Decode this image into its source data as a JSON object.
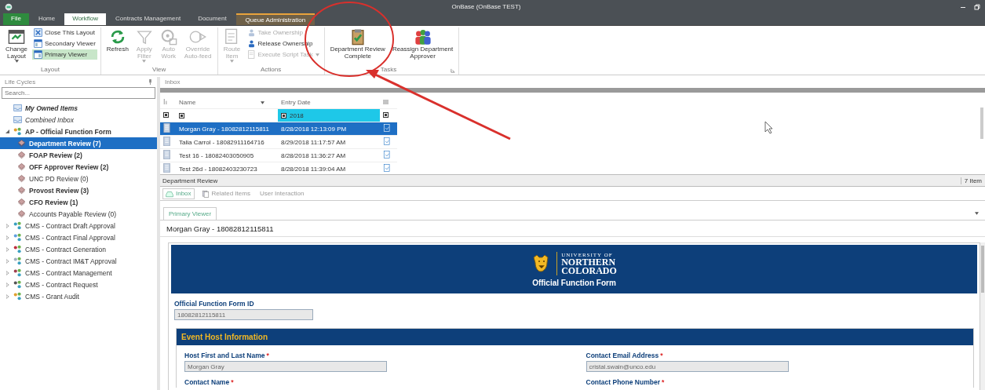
{
  "window": {
    "title": "OnBase (OnBase TEST)"
  },
  "ribbon_tabs": [
    {
      "label": "File",
      "kind": "file",
      "selected": false
    },
    {
      "label": "Home",
      "kind": "normal",
      "selected": false
    },
    {
      "label": "Workflow",
      "kind": "normal",
      "selected": true
    },
    {
      "label": "Contracts Management",
      "kind": "normal",
      "selected": false
    },
    {
      "label": "Document",
      "kind": "normal",
      "selected": false
    },
    {
      "label": "Queue Administration",
      "kind": "contextual",
      "selected": false
    }
  ],
  "ribbon_groups": [
    {
      "label": "Layout",
      "launcher": false,
      "items": [
        {
          "label": "Change\nLayout",
          "kind": "large",
          "dropdown": true,
          "disabled": false,
          "on": false
        },
        {
          "label": "Close This Layout",
          "kind": "small",
          "dropdown": false,
          "disabled": false,
          "on": false
        },
        {
          "label": "Secondary Viewer",
          "kind": "small",
          "dropdown": false,
          "disabled": false,
          "on": false
        },
        {
          "label": "Primary Viewer",
          "kind": "small",
          "dropdown": false,
          "disabled": false,
          "on": true
        }
      ]
    },
    {
      "label": "View",
      "launcher": false,
      "items": [
        {
          "label": "Refresh",
          "kind": "large",
          "dropdown": false,
          "disabled": false,
          "on": false
        },
        {
          "label": "Apply\nFilter",
          "kind": "large",
          "dropdown": true,
          "disabled": true,
          "on": false
        },
        {
          "label": "Auto\nWork",
          "kind": "large",
          "dropdown": false,
          "disabled": true,
          "on": false
        },
        {
          "label": "Override\nAuto-feed",
          "kind": "large",
          "dropdown": false,
          "disabled": true,
          "on": false
        }
      ]
    },
    {
      "label": "Actions",
      "launcher": false,
      "items": [
        {
          "label": "Route\nItem",
          "kind": "large",
          "dropdown": true,
          "disabled": true,
          "on": false
        },
        {
          "label": "Take Ownership",
          "kind": "small",
          "dropdown": false,
          "disabled": true,
          "on": false
        },
        {
          "label": "Release Ownership",
          "kind": "small",
          "dropdown": false,
          "disabled": false,
          "on": false
        },
        {
          "label": "Execute Script Task",
          "kind": "small",
          "dropdown": true,
          "disabled": true,
          "on": false
        }
      ]
    },
    {
      "label": "Tasks",
      "launcher": true,
      "items": [
        {
          "label": "Department Review\nComplete",
          "kind": "large",
          "dropdown": false,
          "disabled": false,
          "on": false
        },
        {
          "label": "Reassign Department\nApprover",
          "kind": "large",
          "dropdown": false,
          "disabled": false,
          "on": false
        }
      ]
    }
  ],
  "sidebar": {
    "title": "Life Cycles",
    "search": {
      "placeholder": "Search..."
    },
    "tree": [
      {
        "label": "My Owned Items",
        "kind": "view",
        "emphasized": true,
        "selected": false
      },
      {
        "label": "Combined Inbox",
        "kind": "view",
        "emphasized": false,
        "selected": false
      },
      {
        "label": "AP - Official Function Form",
        "kind": "lifecycle",
        "emphasized": true,
        "expanded": true,
        "selected": false,
        "children": [
          {
            "label": "Department Review (7)",
            "kind": "queue",
            "emphasized": true,
            "selected": true
          },
          {
            "label": "FOAP Review (2)",
            "kind": "queue",
            "emphasized": true,
            "selected": false
          },
          {
            "label": "OFF Approver Review (2)",
            "kind": "queue",
            "emphasized": true,
            "selected": false
          },
          {
            "label": "UNC PD Review (0)",
            "kind": "queue",
            "emphasized": false,
            "selected": false
          },
          {
            "label": "Provost Review (3)",
            "kind": "queue",
            "emphasized": true,
            "selected": false
          },
          {
            "label": "CFO Review (1)",
            "kind": "queue",
            "emphasized": true,
            "selected": false
          },
          {
            "label": "Accounts Payable Review (0)",
            "kind": "queue",
            "emphasized": false,
            "selected": false
          }
        ]
      },
      {
        "label": "CMS - Contract Draft Approval",
        "kind": "lifecycle",
        "emphasized": false,
        "expanded": false,
        "selected": false
      },
      {
        "label": "CMS - Contract Final Approval",
        "kind": "lifecycle",
        "emphasized": false,
        "expanded": false,
        "selected": false
      },
      {
        "label": "CMS - Contract Generation",
        "kind": "lifecycle",
        "emphasized": false,
        "expanded": false,
        "selected": false
      },
      {
        "label": "CMS - Contract IM&T Approval",
        "kind": "lifecycle",
        "emphasized": false,
        "expanded": false,
        "selected": false
      },
      {
        "label": "CMS - Contract Management",
        "kind": "lifecycle",
        "emphasized": false,
        "expanded": false,
        "selected": false
      },
      {
        "label": "CMS - Contract Request",
        "kind": "lifecycle",
        "emphasized": false,
        "expanded": false,
        "selected": false
      },
      {
        "label": "CMS - Grant Audit",
        "kind": "lifecycle",
        "emphasized": false,
        "expanded": false,
        "selected": false
      }
    ]
  },
  "inbox": {
    "title": "Inbox",
    "table": {
      "columns": [
        {
          "label": "Name"
        },
        {
          "label": "Entry Date"
        }
      ],
      "filters": [
        {
          "active": false
        },
        {
          "value": "2018",
          "active": true
        }
      ],
      "rows": [
        {
          "name": "Morgan Gray - 18082812115811",
          "entry_date": "8/28/2018 12:13:09 PM",
          "selected": true
        },
        {
          "name": "Talia Carrol - 18082911164716",
          "entry_date": "8/29/2018 11:17:57 AM",
          "selected": false
        },
        {
          "name": "Test 16 - 18082403050905",
          "entry_date": "8/28/2018 11:36:27 AM",
          "selected": false
        },
        {
          "name": "Test 26d - 18082403230723",
          "entry_date": "8/28/2018 11:39:04 AM",
          "selected": false
        }
      ]
    },
    "status_bar": {
      "queue": "Department Review",
      "count": "7 Item"
    }
  },
  "detail_tabs": [
    {
      "label": "Inbox",
      "selected": true
    },
    {
      "label": "Related Items",
      "selected": false
    },
    {
      "label": "User Interaction",
      "selected": false
    }
  ],
  "viewer": {
    "tabs": [
      {
        "label": "Primary Viewer",
        "selected": true
      }
    ],
    "document_title": "Morgan Gray - 18082812115811",
    "form": {
      "logo_lines": [
        "UNIVERSITY OF",
        "NORTHERN",
        "COLORADO"
      ],
      "title": "Official Function Form",
      "id_field": {
        "label": "Official Function Form ID",
        "value": "18082812115811"
      },
      "section": {
        "title": "Event Host Information",
        "fields": [
          {
            "label": "Host First and Last Name",
            "required_mark": "*",
            "value": "Morgan Gray"
          },
          {
            "label": "Contact Email Address",
            "required_mark": "*",
            "value": "cristal.swain@unco.edu"
          },
          {
            "label": "Contact Name",
            "required_mark": "*"
          },
          {
            "label": "Contact Phone Number",
            "required_mark": "*"
          }
        ]
      }
    }
  }
}
